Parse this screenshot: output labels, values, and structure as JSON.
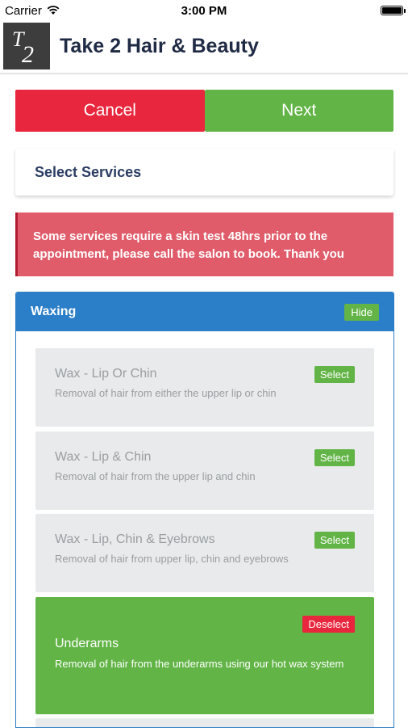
{
  "status_bar": {
    "carrier": "Carrier",
    "time": "3:00 PM",
    "battery_level": 1.0
  },
  "header": {
    "logo_text": "T2",
    "title": "Take 2 Hair & Beauty"
  },
  "actions": {
    "cancel_label": "Cancel",
    "next_label": "Next"
  },
  "section_title": "Select Services",
  "notice": "Some services require a skin test 48hrs prior to the appointment, please call the salon to book. Thank you",
  "category": {
    "name": "Waxing",
    "hide_label": "Hide",
    "services": [
      {
        "name": "Wax - Lip Or Chin",
        "description": "Removal of hair from either the upper lip or chin",
        "action": "Select"
      },
      {
        "name": "Wax - Lip & Chin",
        "description": "Removal of hair from the upper lip and chin",
        "action": "Select"
      },
      {
        "name": "Wax - Lip, Chin & Eyebrows",
        "description": "Removal of hair from upper lip, chin and eyebrows",
        "action": "Select"
      },
      {
        "name": "Underarms",
        "description": "Removal of hair from the underarms using our hot wax system",
        "action": "Deselect"
      }
    ]
  },
  "colors": {
    "accent_blue": "#2b7fc8",
    "green": "#62b446",
    "red": "#e8263d"
  }
}
